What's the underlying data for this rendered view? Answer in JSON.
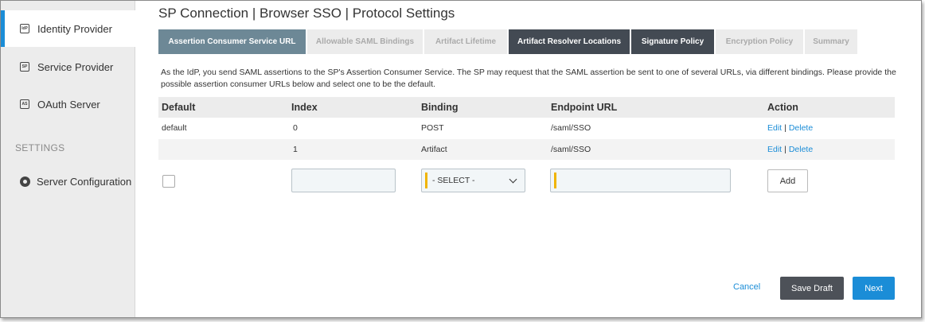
{
  "sidebar": {
    "items": [
      {
        "label": "Identity Provider",
        "icon": "IdP"
      },
      {
        "label": "Service Provider",
        "icon": "SP"
      },
      {
        "label": "OAuth Server",
        "icon": "AS"
      }
    ],
    "settings_heading": "SETTINGS",
    "server_config_label": "Server Configuration"
  },
  "page": {
    "title": "SP Connection | Browser SSO | Protocol Settings",
    "tabs": [
      {
        "label": "Assertion Consumer Service URL",
        "state": "active"
      },
      {
        "label": "Allowable SAML Bindings",
        "state": "disabled"
      },
      {
        "label": "Artifact Lifetime",
        "state": "disabled"
      },
      {
        "label": "Artifact Resolver Locations",
        "state": "visited"
      },
      {
        "label": "Signature Policy",
        "state": "visited"
      },
      {
        "label": "Encryption Policy",
        "state": "disabled"
      },
      {
        "label": "Summary",
        "state": "disabled"
      }
    ],
    "description": "As the IdP, you send SAML assertions to the SP's Assertion Consumer Service. The SP may request that the SAML assertion be sent to one of several URLs, via different bindings. Please provide the possible assertion consumer URLs below and select one to be the default."
  },
  "table": {
    "headers": {
      "default": "Default",
      "index": "Index",
      "binding": "Binding",
      "endpoint": "Endpoint URL",
      "action": "Action"
    },
    "rows": [
      {
        "default": "default",
        "index": "0",
        "binding": "POST",
        "endpoint": "/saml/SSO",
        "edit": "Edit",
        "separator": "|",
        "delete": "Delete"
      },
      {
        "default": "",
        "index": "1",
        "binding": "Artifact",
        "endpoint": "/saml/SSO",
        "edit": "Edit",
        "separator": "|",
        "delete": "Delete"
      }
    ],
    "new_row": {
      "index_value": "",
      "binding_selected": "- SELECT -",
      "endpoint_value": "",
      "add_label": "Add"
    }
  },
  "footer": {
    "cancel_label": "Cancel",
    "save_draft_label": "Save Draft",
    "next_label": "Next"
  },
  "colors": {
    "accent": "#1b8dd7",
    "active_tab": "#6d8896",
    "visited_tab": "#434a53",
    "required_marker": "#f0b400"
  }
}
